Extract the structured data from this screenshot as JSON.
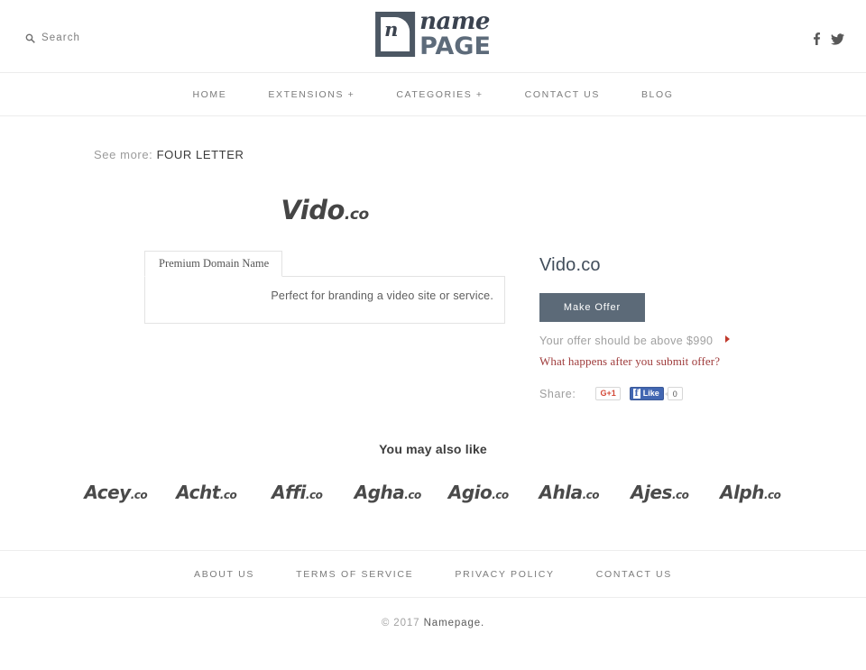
{
  "header": {
    "search": {
      "label": "Search",
      "icon": "search-icon"
    },
    "logo": {
      "mark_letter": "n",
      "name": "name",
      "page": "PAGE"
    },
    "social": [
      {
        "name": "facebook-icon",
        "glyph": "f"
      },
      {
        "name": "twitter-icon",
        "glyph": "twitter"
      }
    ]
  },
  "nav": {
    "items": [
      {
        "label": "HOME"
      },
      {
        "label": "EXTENSIONS +"
      },
      {
        "label": "CATEGORIES +"
      },
      {
        "label": "CONTACT US"
      },
      {
        "label": "BLOG"
      }
    ]
  },
  "breadcrumb": {
    "label": "See more:",
    "link": "FOUR LETTER"
  },
  "domain": {
    "name": "Vido",
    "tld": ".co",
    "full": "Vido.co"
  },
  "details": {
    "tab_label": "Premium Domain Name",
    "description": "Perfect for branding a video site or service."
  },
  "offer": {
    "button_label": "Make Offer",
    "note": "Your offer should be above $990",
    "minimum": "$990",
    "link": "What happens after you submit offer?"
  },
  "share": {
    "label": "Share:",
    "gplus_label": "G+1",
    "fb_like_label": "Like",
    "fb_count": "0"
  },
  "also_like": {
    "title": "You may also like",
    "items": [
      {
        "name": "Acey",
        "tld": ".co"
      },
      {
        "name": "Acht",
        "tld": ".co"
      },
      {
        "name": "Affi",
        "tld": ".co"
      },
      {
        "name": "Agha",
        "tld": ".co"
      },
      {
        "name": "Agio",
        "tld": ".co"
      },
      {
        "name": "Ahla",
        "tld": ".co"
      },
      {
        "name": "Ajes",
        "tld": ".co"
      },
      {
        "name": "Alph",
        "tld": ".co"
      }
    ]
  },
  "footer": {
    "links": [
      {
        "label": "ABOUT US"
      },
      {
        "label": "TERMS OF SERVICE"
      },
      {
        "label": "PRIVACY POLICY"
      },
      {
        "label": "CONTACT US"
      }
    ],
    "copyright_prefix": "© 2017",
    "brand": "Namepage."
  },
  "colors": {
    "accent_button": "#5c6a78",
    "heading": "#414d5a",
    "link_red": "#9e3a3a",
    "muted": "#a0a0a0"
  }
}
